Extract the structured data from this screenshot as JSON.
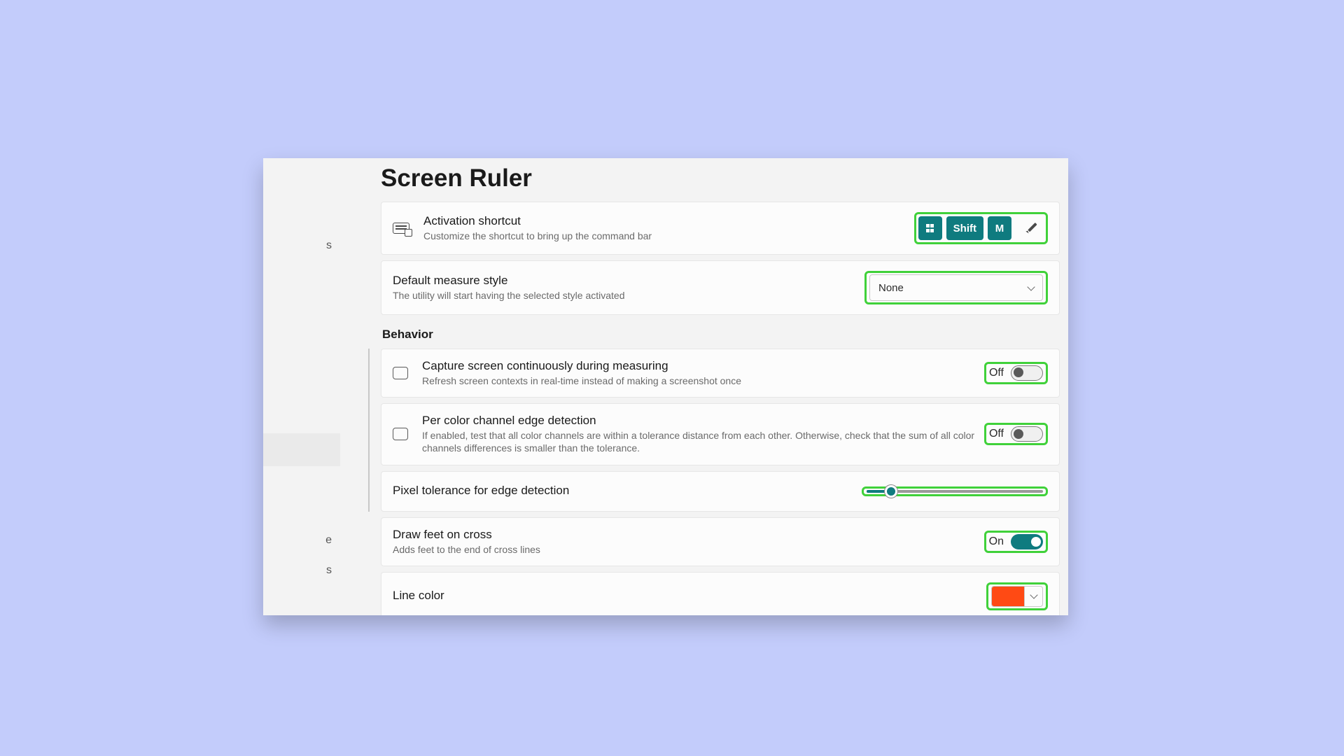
{
  "page": {
    "title": "Screen Ruler"
  },
  "sidebar": {
    "fragments": [
      "s",
      "e",
      "s"
    ]
  },
  "shortcut": {
    "title": "Activation shortcut",
    "subtitle": "Customize the shortcut to bring up the command bar",
    "keys": [
      "Win",
      "Shift",
      "M"
    ]
  },
  "measure_style": {
    "title": "Default measure style",
    "subtitle": "The utility will start having the selected style activated",
    "value": "None"
  },
  "section_behavior": "Behavior",
  "capture": {
    "title": "Capture screen continuously during measuring",
    "subtitle": "Refresh screen contexts in real-time instead of making a screenshot once",
    "state_label": "Off",
    "on": false
  },
  "color_channel": {
    "title": "Per color channel edge detection",
    "subtitle": "If enabled, test that all color channels are within a tolerance distance from each other. Otherwise, check that the sum of all color channels differences is smaller than the tolerance.",
    "state_label": "Off",
    "on": false
  },
  "pixel_tol": {
    "title": "Pixel tolerance for edge detection",
    "value_pct": 14
  },
  "draw_feet": {
    "title": "Draw feet on cross",
    "subtitle": "Adds feet to the end of cross lines",
    "state_label": "On",
    "on": true
  },
  "line_color": {
    "title": "Line color",
    "hex": "#ff4a14"
  }
}
